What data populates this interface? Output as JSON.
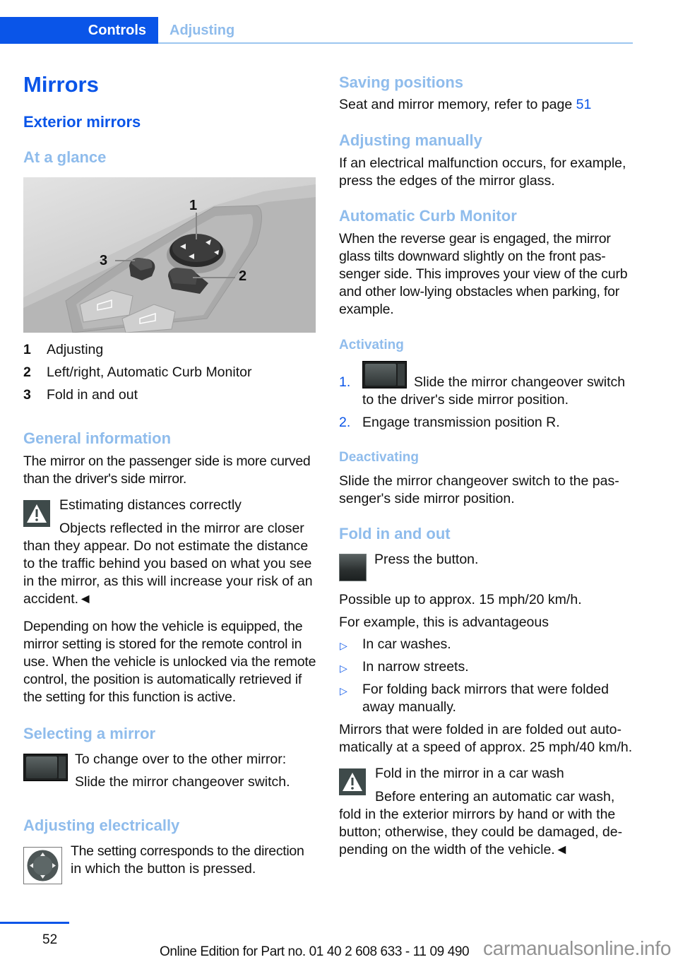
{
  "header": {
    "tabs": [
      {
        "label": "Controls",
        "active": true
      },
      {
        "label": "Adjusting",
        "active": false
      }
    ]
  },
  "left": {
    "title": "Mirrors",
    "subtitle": "Exterior mirrors",
    "at_a_glance": "At a glance",
    "figure": {
      "callouts": [
        "1",
        "2",
        "3"
      ]
    },
    "legend": [
      {
        "num": "1",
        "text": "Adjusting"
      },
      {
        "num": "2",
        "text": "Left/right, Automatic Curb Monitor"
      },
      {
        "num": "3",
        "text": "Fold in and out"
      }
    ],
    "general_info": {
      "heading": "General information",
      "body": "The mirror on the passenger side is more curved than the driver's side mirror."
    },
    "warning1": {
      "title": "Estimating distances correctly",
      "line1": "Objects reflected in the mirror are closer",
      "rest": "than they appear. Do not estimate the distance to the traffic behind you based on what you see in the mirror, as this will increase your risk of an accident.◄"
    },
    "memory_para": "Depending on how the vehicle is equipped, the mirror setting is stored for the remote control in use. When the vehicle is unlocked via the remote control, the position is automatically retrieved if the setting for this function is active.",
    "selecting": {
      "heading": "Selecting a mirror",
      "line1": "To change over to the other mirror:",
      "line2": "Slide the mirror changeover switch."
    },
    "adjusting_electrically": {
      "heading": "Adjusting electrically",
      "line1": "The setting corresponds to the direction",
      "line2": "in which the button is pressed."
    }
  },
  "right": {
    "saving": {
      "heading": "Saving positions",
      "text": "Seat and mirror memory, refer to page ",
      "page_link": "51"
    },
    "manual": {
      "heading": "Adjusting manually",
      "body": "If an electrical malfunction occurs, for example, press the edges of the mirror glass."
    },
    "curb_monitor": {
      "heading": "Automatic Curb Monitor",
      "body": "When the reverse gear is engaged, the mirror glass tilts downward slightly on the front pas-senger side. This improves your view of the curb and other low-lying obstacles when parking, for example."
    },
    "activating": {
      "heading": "Activating",
      "steps": [
        {
          "num": "1.",
          "text_first": "Slide the mirror changeover switch",
          "text_rest": "to the driver's side mirror position."
        },
        {
          "num": "2.",
          "text_first": "Engage transmission position R."
        }
      ]
    },
    "deactivating": {
      "heading": "Deactivating",
      "body": "Slide the mirror changeover switch to the pas-senger's side mirror position."
    },
    "fold": {
      "heading": "Fold in and out",
      "press": "Press the button.",
      "speed": "Possible up to approx. 15 mph/20 km/h.",
      "example_intro": "For example, this is advantageous",
      "bullets": [
        "In car washes.",
        "In narrow streets.",
        "For folding back mirrors that were folded away manually."
      ],
      "auto_out": "Mirrors that were folded in are folded out auto-matically at a speed of approx. 25 mph/40 km/h."
    },
    "warning2": {
      "title": "Fold in the mirror in a car wash",
      "line1": "Before entering an automatic car wash,",
      "rest": "fold in the exterior mirrors by hand or with the button; otherwise, they could be damaged, de-pending on the width of the vehicle.◄"
    }
  },
  "footer": {
    "page_number": "52",
    "edition": "Online Edition for Part no. 01 40 2 608 633 - 11 09 490",
    "watermark": "carmanualsonline.info"
  },
  "colors": {
    "accent": "#0a55e8",
    "heading_light": "#8fbcec",
    "warning_bg": "#3e4a4a"
  }
}
